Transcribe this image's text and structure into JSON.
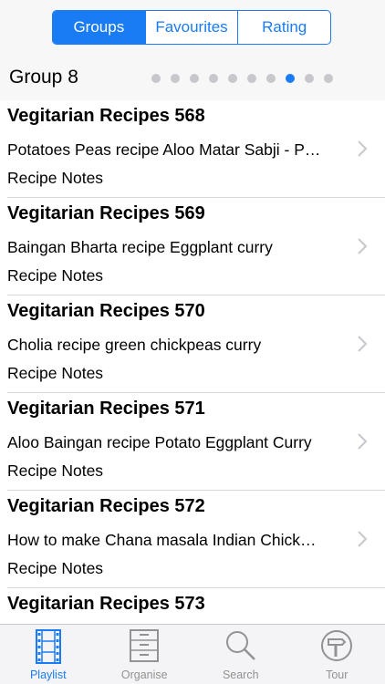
{
  "segments": [
    {
      "label": "Groups",
      "active": true
    },
    {
      "label": "Favourites",
      "active": false
    },
    {
      "label": "Rating",
      "active": false
    }
  ],
  "group": {
    "title": "Group 8",
    "page_count": 10,
    "current_page_index": 7
  },
  "rows": [
    {
      "title": "Vegitarian Recipes 568",
      "subtitle": "Potatoes Peas recipe Aloo Matar Sabji - Potato Peas Curry",
      "notes": "Recipe Notes"
    },
    {
      "title": "Vegitarian Recipes 569",
      "subtitle": "Baingan Bharta recipe Eggplant curry",
      "notes": "Recipe Notes"
    },
    {
      "title": "Vegitarian Recipes 570",
      "subtitle": "Cholia recipe green chickpeas curry",
      "notes": "Recipe Notes"
    },
    {
      "title": "Vegitarian Recipes 571",
      "subtitle": "Aloo Baingan recipe Potato Eggplant Curry",
      "notes": "Recipe Notes"
    },
    {
      "title": "Vegitarian Recipes 572",
      "subtitle": "How to make Chana masala Indian Chickpea Curry",
      "notes": "Recipe Notes"
    },
    {
      "title": "Vegitarian Recipes 573",
      "subtitle": "",
      "notes": ""
    }
  ],
  "tabs": [
    {
      "label": "Playlist",
      "icon": "film-strip-icon",
      "active": true
    },
    {
      "label": "Organise",
      "icon": "cabinet-icon",
      "active": false
    },
    {
      "label": "Search",
      "icon": "magnifier-icon",
      "active": false
    },
    {
      "label": "Tour",
      "icon": "signpost-icon",
      "active": false
    }
  ],
  "colors": {
    "accent": "#1a7cf5",
    "inactive_tab": "#929292",
    "dot_inactive": "#c7c7cc"
  }
}
